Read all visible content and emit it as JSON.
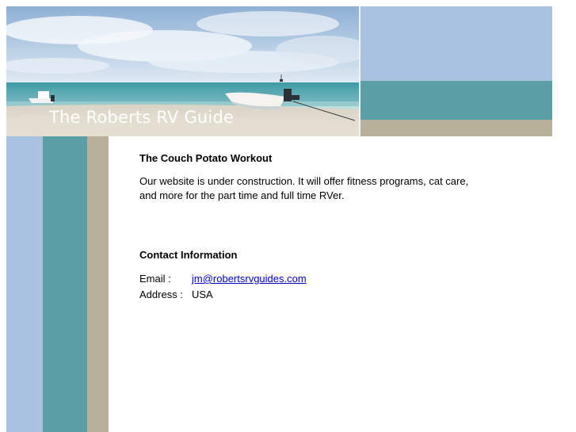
{
  "header": {
    "site_title": "The Roberts RV Guide"
  },
  "main": {
    "title": "The Couch Potato Workout",
    "description_line1": "Our website is under construction. It will offer fitness programs, cat care,",
    "description_line2": "and more for the part time and full time RVer."
  },
  "contact": {
    "heading": "Contact Information",
    "email_label": "Email :",
    "email_value": "jm@robertsrvguides.com",
    "address_label": "Address :",
    "address_value": "USA"
  },
  "colors": {
    "sky_blue": "#a9c2e0",
    "sea_teal": "#5a9ea6",
    "sand": "#b9b09c",
    "link": "#0000cc"
  }
}
